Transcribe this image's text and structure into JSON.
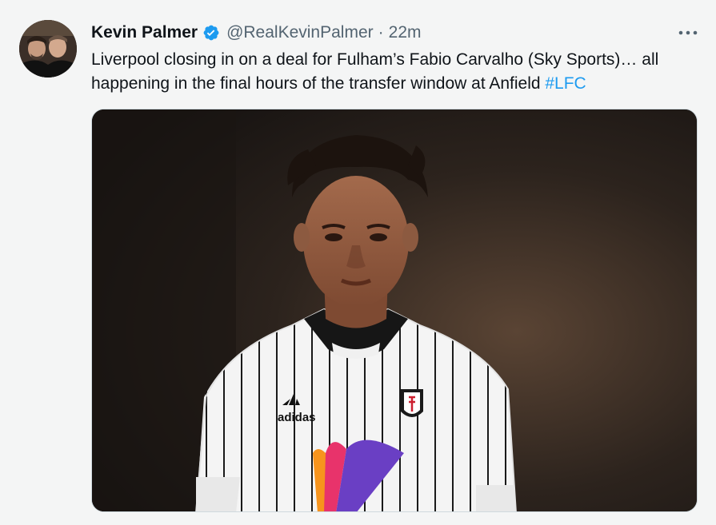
{
  "tweet": {
    "author_name": "Kevin Palmer",
    "handle": "@RealKevinPalmer",
    "separator": "·",
    "time": "22m",
    "text": "Liverpool closing in on a deal for Fulham’s Fabio Carvalho (Sky Sports)… all happening in the final hours of the transfer window at Anfield ",
    "hashtag": "#LFC",
    "verified": true
  },
  "colors": {
    "link": "#1d9bf0",
    "verified_badge": "#1d9bf0",
    "secondary_text": "#536471"
  },
  "icons": {
    "verified": "verified-badge-icon",
    "more": "more-dots-icon"
  },
  "media": {
    "kit_brand": "adidas"
  }
}
